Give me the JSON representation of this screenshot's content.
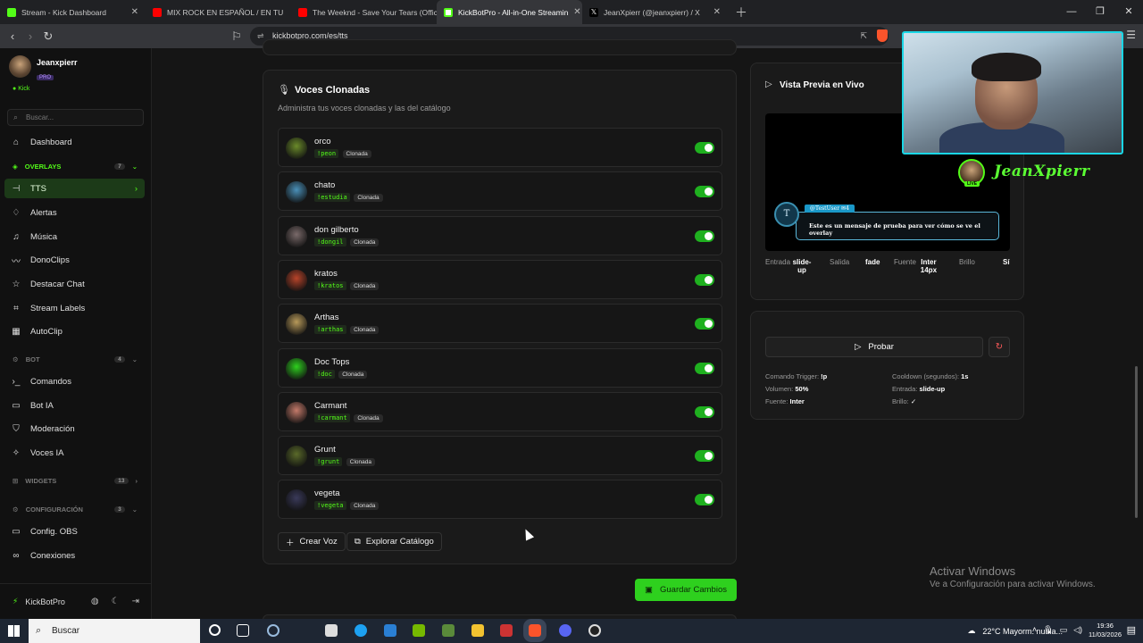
{
  "browser": {
    "tabs": [
      {
        "label": "Stream - Kick Dashboard",
        "color": "#53fc18"
      },
      {
        "label": "MIX ROCK EN ESPAÑOL / EN TU",
        "color": "#ff0000"
      },
      {
        "label": "The Weeknd - Save Your Tears (Offici",
        "color": "#ff0000"
      },
      {
        "label": "KickBotPro - All-in-One Streamin",
        "color": "#53fc18"
      },
      {
        "label": "JeanXpierr (@jeanxpierr) / X",
        "color": "#000000"
      }
    ],
    "url": "kickbotpro.com/es/tts"
  },
  "sidebar": {
    "username": "Jeanxpierr",
    "plan": "PRO",
    "platform": "Kick",
    "search_placeholder": "Buscar...",
    "dashboard": "Dashboard",
    "overlays_group": {
      "label": "OVERLAYS",
      "count": "7"
    },
    "overlay_items": [
      "TTS",
      "Alertas",
      "Música",
      "DonoClips",
      "Destacar Chat",
      "Stream Labels",
      "AutoClip"
    ],
    "bot_group": {
      "label": "BOT",
      "count": "4"
    },
    "bot_items": [
      "Comandos",
      "Bot IA",
      "Moderación",
      "Voces IA"
    ],
    "widgets_group": {
      "label": "WIDGETS",
      "count": "13"
    },
    "config_group": {
      "label": "CONFIGURACIÓN",
      "count": "3"
    },
    "config_items": [
      "Config. OBS",
      "Conexiones"
    ],
    "footer_brand": "KickBotPro"
  },
  "voices_card": {
    "title": "Voces Clonadas",
    "subtitle": "Administra tus voces clonadas y las del catálogo",
    "voices": [
      {
        "name": "orco",
        "command": "!peon",
        "tag": "Clonada",
        "enabled": true,
        "color": "#6a8a2a"
      },
      {
        "name": "chato",
        "command": "!estudia",
        "tag": "Clonada",
        "enabled": true,
        "color": "#4a90b8"
      },
      {
        "name": "don gilberto",
        "command": "!dongil",
        "tag": "Clonada",
        "enabled": true,
        "color": "#7a6a6a"
      },
      {
        "name": "kratos",
        "command": "!kratos",
        "tag": "Clonada",
        "enabled": true,
        "color": "#b8442a"
      },
      {
        "name": "Arthas",
        "command": "!arthas",
        "tag": "Clonada",
        "enabled": true,
        "color": "#b89a5a"
      },
      {
        "name": "Doc Tops",
        "command": "!doc",
        "tag": "Clonada",
        "enabled": true,
        "color": "#2ed01e"
      },
      {
        "name": "Carmant",
        "command": "!carmant",
        "tag": "Clonada",
        "enabled": true,
        "color": "#c47a6a"
      },
      {
        "name": "Grunt",
        "command": "!grunt",
        "tag": "Clonada",
        "enabled": true,
        "color": "#5a6a2a"
      },
      {
        "name": "vegeta",
        "command": "!vegeta",
        "tag": "Clonada",
        "enabled": true,
        "color": "#3a3a5a"
      }
    ],
    "create_button": "Crear Voz",
    "catalog_button": "Explorar Catálogo"
  },
  "save_button": "Guardar Cambios",
  "preview": {
    "title": "Vista Previa en Vivo",
    "chat_user": "@TestUser ✉4",
    "chat_avatar_letter": "T",
    "chat_message": "Este es un mensaje de prueba para ver cómo se ve el overlay",
    "stats": [
      {
        "label": "Entrada",
        "value": "slide-up"
      },
      {
        "label": "Salida",
        "value": ""
      },
      {
        "label": "",
        "value": "fade"
      },
      {
        "label": "Fuente",
        "value": "Inter 14px"
      },
      {
        "label": "Brillo",
        "value": ""
      },
      {
        "label": "",
        "value": "Sí"
      }
    ]
  },
  "test_card": {
    "button": "Probar",
    "trigger_label": "Comando Trigger:",
    "trigger_value": "!p",
    "cooldown_label": "Cooldown (segundos):",
    "cooldown_value": "1s",
    "volume_label": "Volumen:",
    "volume_value": "50%",
    "entry_label": "Entrada:",
    "entry_value": "slide-up",
    "font_label": "Fuente:",
    "font_value": "Inter",
    "brightness_label": "Brillo:",
    "brightness_value": "✓"
  },
  "overlay_brand": "JeanXpierr",
  "live_badge": "LIVE",
  "windows": {
    "activate_title": "Activar Windows",
    "activate_sub": "Ve a Configuración para activar Windows.",
    "search": "Buscar",
    "weather": "22°C  Mayorm. nubla...",
    "time": "19:36",
    "date": "11/03/2026"
  }
}
